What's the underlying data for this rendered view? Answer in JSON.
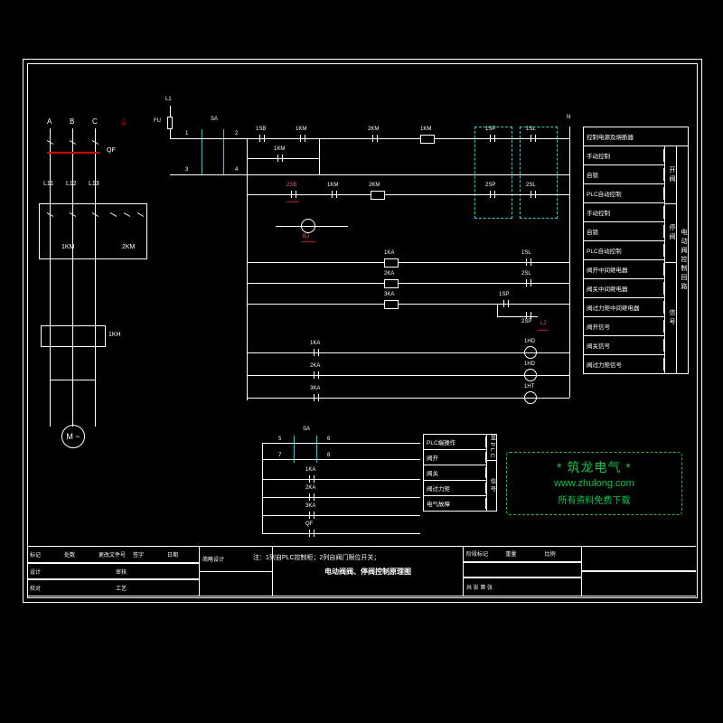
{
  "phases": {
    "a": "A",
    "b": "B",
    "c": "C"
  },
  "motor": {
    "fuse": "FU",
    "breaker": "QF",
    "lines": {
      "l1": "L11",
      "l2": "L12",
      "l3": "L13"
    },
    "km1": "1KM",
    "km2": "2KM",
    "kh": "1KH",
    "symbol": "M\n~"
  },
  "topbus": {
    "fu": "FU",
    "l1": "L1",
    "l2": "L2",
    "n": "N",
    "sa": "SA",
    "markers": [
      "1",
      "2",
      "3",
      "4",
      "5",
      "6",
      "7",
      "8"
    ],
    "components": [
      "1SB",
      "1KM",
      "2KM",
      "1KM",
      "1SP",
      "1SL",
      "2SB",
      "1KM",
      "2KM",
      "2SP",
      "2SL",
      "1KA",
      "2KA",
      "3KA",
      "BJ"
    ]
  },
  "rung_labels": {
    "r1": [
      "1SB",
      "1KM",
      "2KM",
      "1KM",
      "1SP",
      "1SL"
    ],
    "r2": [
      "1KM"
    ],
    "r3": [
      "2SB",
      "1KM",
      "2KM",
      "2SP",
      "2SL"
    ],
    "r4": [
      "BJ"
    ],
    "r5": [
      "1KA",
      "1SL"
    ],
    "r6": [
      "2KA",
      "2SL"
    ],
    "r7": [
      "3KA",
      "1SP",
      "2SP"
    ],
    "r8": [
      "1KA",
      "1HD"
    ],
    "r9": [
      "2KA",
      "1HD"
    ],
    "r10": [
      "3KA",
      "1HT"
    ]
  },
  "desc": {
    "header": "控制电源及熔断器",
    "rows": [
      "手动控制",
      "自锁",
      "PLC自动控制",
      "手动控制",
      "自锁",
      "PLC自动控制",
      "阀开中间继电器",
      "阀关中间继电器",
      "阀过力矩中间继电器",
      "阀开信号",
      "阀关信号",
      "阀过力矩信号"
    ],
    "side_groups": [
      "开阀",
      "停阀",
      "信号"
    ],
    "side_outer": "电动阀控制回路"
  },
  "plc": {
    "sa": "SA",
    "nums": [
      "5",
      "6",
      "7",
      "8"
    ],
    "inputs": [
      "1KA",
      "2KA",
      "3KA",
      "QF"
    ],
    "rows": [
      "PLC端操作",
      "阀开",
      "阀关",
      "阀过力矩",
      "电气故障"
    ],
    "side": [
      "至PLC",
      "信号"
    ]
  },
  "note": "注：1列自PLC控制柜；2列自阀门限位开关；",
  "watermark": {
    "line1": "*  筑龙电气  *",
    "line2": "www.zhulong.com",
    "line3": "所有资料免费下载"
  },
  "titleblock": {
    "rev_headers": [
      "标记",
      "处数",
      "更改文件号",
      "签字",
      "日期"
    ],
    "roles": [
      "设计",
      "校对",
      "审核",
      "工艺"
    ],
    "title": "电动阀阀、停阀控制原理图",
    "project": "简略设计",
    "scale_lbl": "比例",
    "sheet_lbl": "共 张 第 张",
    "stage": "阶段标记",
    "weight": "重量"
  }
}
